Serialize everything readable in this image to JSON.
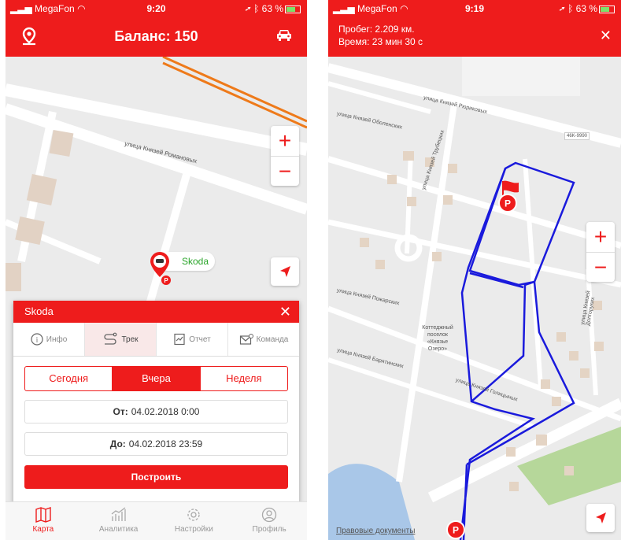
{
  "left": {
    "status": {
      "carrier": "MegaFon",
      "time": "9:20",
      "battery": "63 %"
    },
    "header": {
      "title": "Баланс: 150",
      "left_icon": "location-pin-icon",
      "right_icon": "car-icon"
    },
    "map": {
      "streets": [
        "улица Князей Романовых"
      ],
      "vehicle_label": "Skoda",
      "zoom_in": "+",
      "zoom_out": "−"
    },
    "panel": {
      "title": "Skoda",
      "tabs": [
        {
          "label": "Инфо",
          "icon": "info-icon",
          "active": false
        },
        {
          "label": "Трек",
          "icon": "track-icon",
          "active": true
        },
        {
          "label": "Отчет",
          "icon": "report-icon",
          "active": false
        },
        {
          "label": "Команда",
          "icon": "command-icon",
          "active": false
        }
      ],
      "periods": [
        "Сегодня",
        "Вчера",
        "Неделя"
      ],
      "active_period": "Вчера",
      "from_label": "От:",
      "from_value": "04.02.2018 0:00",
      "to_label": "До:",
      "to_value": "04.02.2018 23:59",
      "build_label": "Построить"
    },
    "nav": [
      {
        "label": "Карта",
        "icon": "map-icon",
        "active": true
      },
      {
        "label": "Аналитика",
        "icon": "analytics-icon",
        "active": false
      },
      {
        "label": "Настройки",
        "icon": "settings-gear-icon",
        "active": false
      },
      {
        "label": "Профиль",
        "icon": "profile-icon",
        "active": false
      }
    ]
  },
  "right": {
    "status": {
      "carrier": "MegaFon",
      "time": "9:19",
      "battery": "63 %"
    },
    "trip": {
      "distance": "Пробег: 2.209 км.",
      "duration": "Время: 23 мин 30 с"
    },
    "map": {
      "streets": [
        "улица Князей Рюриковых",
        "улица Князей Трубецких",
        "улица Князей Оболенских",
        "улица Князей Пожарских",
        "улица Князей Долгоруких",
        "улица Князей Барятинских",
        "улица Князей Голицыных"
      ],
      "village": "Коттеджный поселок «Князье Озеро»",
      "road_sign": "46K-9990",
      "legal": "Правовые документы",
      "zoom_in": "+",
      "zoom_out": "−"
    },
    "colors": {
      "accent": "#ee1c1c",
      "track": "#1a1adc",
      "water": "#a9c7e8",
      "park": "#b6d79a"
    }
  }
}
